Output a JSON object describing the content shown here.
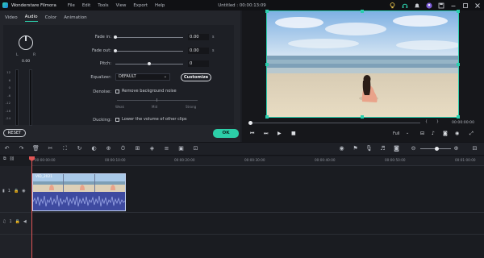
{
  "titlebar": {
    "app_name": "Wonderstare Filmora",
    "menus": [
      "File",
      "Edit",
      "Tools",
      "View",
      "Export",
      "Help"
    ],
    "document": "Untitled : 00:00:13:09"
  },
  "panel": {
    "tabs": [
      "Video",
      "Audio",
      "Color",
      "Animation"
    ],
    "active_tab": "Audio",
    "meter": {
      "left_label": "L",
      "right_label": "R",
      "db_value": "0.00",
      "scale": [
        "12",
        "6",
        "0",
        "-6",
        "-12",
        "-18",
        "-24",
        "-30",
        "-36",
        "-42",
        "-48"
      ]
    },
    "fade_in": {
      "label": "Fade in:",
      "value": "0.00",
      "unit": "s",
      "level": 0
    },
    "fade_out": {
      "label": "Fade out:",
      "value": "0.00",
      "unit": "s",
      "level": 0
    },
    "pitch": {
      "label": "Pitch:",
      "value": "0",
      "level": 0.5
    },
    "equalizer": {
      "label": "Equalizer:",
      "selected": "DEFAULT",
      "customize_label": "Customize"
    },
    "denoise": {
      "label": "Denoise:",
      "checkbox_label": "Remove background noise",
      "weak": "Weak",
      "mid": "Mid",
      "strong": "Strong"
    },
    "ducking": {
      "label": "Ducking:",
      "checkbox_label": "Lower the volume of other clips"
    },
    "reset_label": "RESET",
    "ok_label": "OK"
  },
  "preview": {
    "bracket_left": "{",
    "bracket_right": "}",
    "timecode": "00:00:00:00",
    "quality": "Full",
    "progress": 0
  },
  "timeline": {
    "ruler": [
      "00:00:00:00",
      "00:00:10:00",
      "00:00:20:00",
      "00:00:30:00",
      "00:00:40:00",
      "00:00:50:00",
      "00:01:00:00",
      "00:01:10:00"
    ],
    "tracks": [
      {
        "label": "1"
      },
      {
        "label": "1"
      }
    ],
    "clip": {
      "name": "VID_2021"
    }
  },
  "colors": {
    "accent": "#2dd4b0",
    "playhead": "#e05555",
    "clip_audio": "#3e4aa0"
  }
}
